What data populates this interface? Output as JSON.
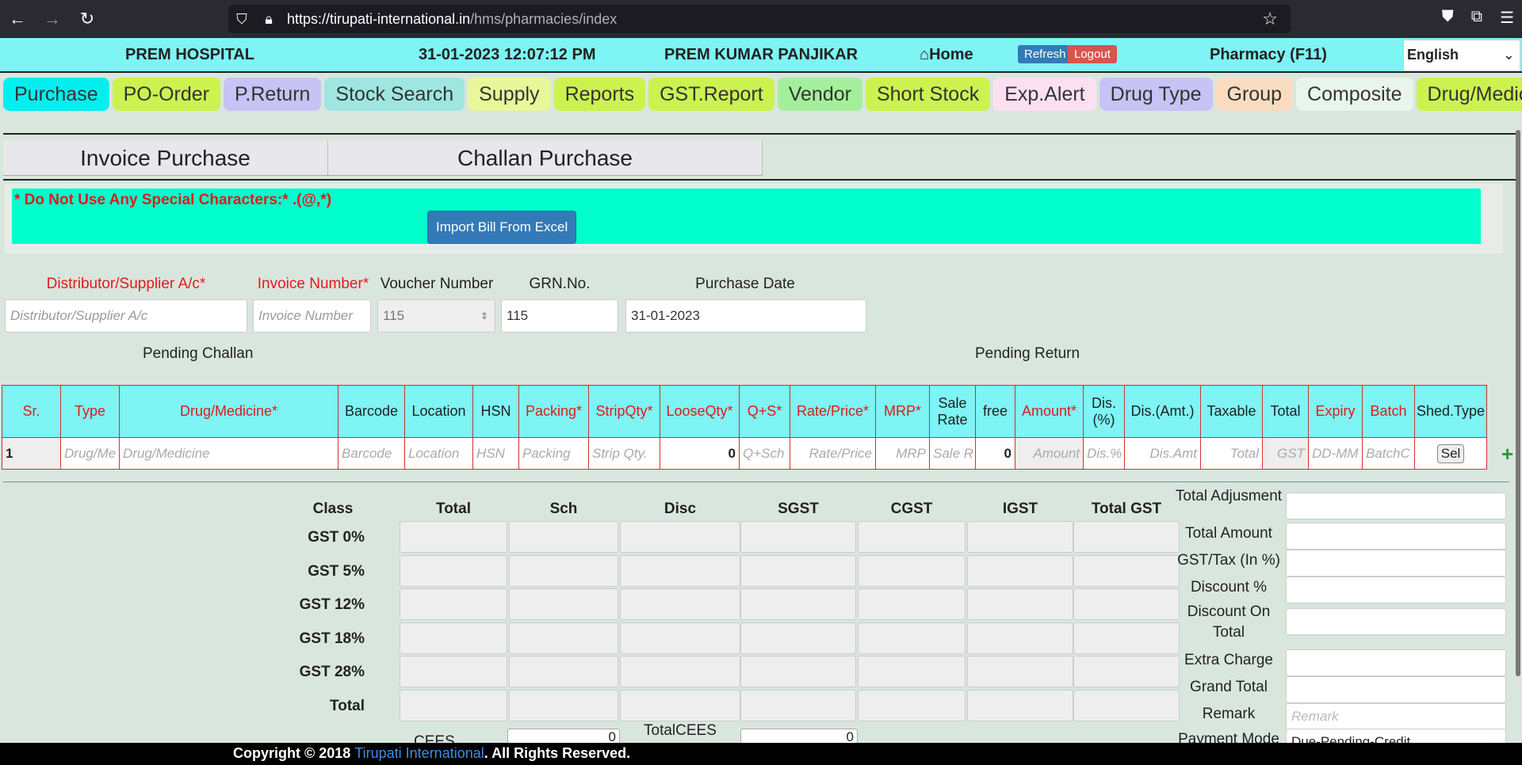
{
  "browser": {
    "url_prefix": "https://tirupati-international.in",
    "url_path": "/hms/pharmacies/index"
  },
  "header": {
    "hospital": "PREM HOSPITAL",
    "datetime": "31-01-2023 12:07:12 PM",
    "user": "PREM KUMAR PANJIKAR",
    "home": "Home",
    "refresh": "Refresh",
    "logout": "Logout",
    "module": "Pharmacy (F11)",
    "language": "English"
  },
  "tabs": [
    {
      "label": "Purchase",
      "color": "#00f0f0"
    },
    {
      "label": "PO-Order",
      "color": "#ccf24f"
    },
    {
      "label": "P.Return",
      "color": "#c7c3f4"
    },
    {
      "label": "Stock Search",
      "color": "#9fe6e0"
    },
    {
      "label": "Supply",
      "color": "#e8f79a"
    },
    {
      "label": "Reports",
      "color": "#ccf24f"
    },
    {
      "label": "GST.Report",
      "color": "#ccf24f"
    },
    {
      "label": "Vendor",
      "color": "#a4ef9b"
    },
    {
      "label": "Short Stock",
      "color": "#ccf24f"
    },
    {
      "label": "Exp.Alert",
      "color": "#fce0f2"
    },
    {
      "label": "Drug Type",
      "color": "#c7c3f4"
    },
    {
      "label": "Group",
      "color": "#f9dcc0"
    },
    {
      "label": "Composite",
      "color": "#e8f5ea"
    },
    {
      "label": "Drug/Medicine",
      "color": "#ccf24f"
    }
  ],
  "purchase_tabs": {
    "invoice": "Invoice Purchase",
    "challan": "Challan Purchase"
  },
  "notice": {
    "warning": "* Do Not Use Any Special Characters:* .(@,*)",
    "import_button": "Import Bill From Excel"
  },
  "form": {
    "distributor_label": "Distributor/Supplier A/c*",
    "distributor_placeholder": "Distributor/Supplier A/c",
    "invoice_label": "Invoice Number*",
    "invoice_placeholder": "Invoice Number",
    "voucher_label": "Voucher Number",
    "voucher_value": "115",
    "grn_label": "GRN.No.",
    "grn_value": "115",
    "date_label": "Purchase Date",
    "date_value": "31-01-2023",
    "pending_challan": "Pending Challan",
    "pending_return": "Pending Return"
  },
  "item_table": {
    "headers": [
      "Sr.",
      "Type",
      "Drug/Medicine*",
      "Barcode",
      "Location",
      "HSN",
      "Packing*",
      "StripQty*",
      "LooseQty*",
      "Q+S*",
      "Rate/Price*",
      "MRP*",
      "Sale Rate",
      "free",
      "Amount*",
      "Dis.(%)",
      "Dis.(Amt.)",
      "Taxable",
      "Total",
      "Expiry",
      "Batch",
      "Shed.Type"
    ],
    "row": [
      "1",
      "Drug/Me",
      "Drug/Medicine",
      "Barcode",
      "Location",
      "HSN",
      "Packing",
      "Strip Qty.",
      "0",
      "Q+Sch",
      "Rate/Price",
      "MRP",
      "Sale R",
      "0",
      "Amount",
      "Dis.%",
      "Dis.Amt",
      "Total",
      "GST",
      "DD-MM",
      "BatchC",
      "Sel"
    ]
  },
  "gst_table": {
    "headers": [
      "Class",
      "Total",
      "Sch",
      "Disc",
      "SGST",
      "CGST",
      "IGST",
      "Total GST"
    ],
    "rows": [
      "GST 0%",
      "GST 5%",
      "GST 12%",
      "GST 18%",
      "GST 28%",
      "Total"
    ],
    "cees_label": "CEES IN %",
    "cees_value": "0",
    "total_cees_label": "TotalCEES",
    "total_cees_value": "0"
  },
  "summary": {
    "total_adjustment": "Total Adjusment",
    "total_amount": "Total Amount",
    "gst_tax": "GST/Tax (In %)",
    "discount_pct": "Discount %",
    "discount_on_total": "Discount On Total",
    "extra_charge": "Extra Charge",
    "grand_total": "Grand Total",
    "remark": "Remark",
    "remark_placeholder": "Remark",
    "payment_mode": "Payment Mode",
    "payment_value": "Due-Pending-Credit"
  },
  "footer": {
    "prefix": "Copyright © 2018 ",
    "company": "Tirupati International",
    "suffix": ". All Rights Reserved."
  }
}
